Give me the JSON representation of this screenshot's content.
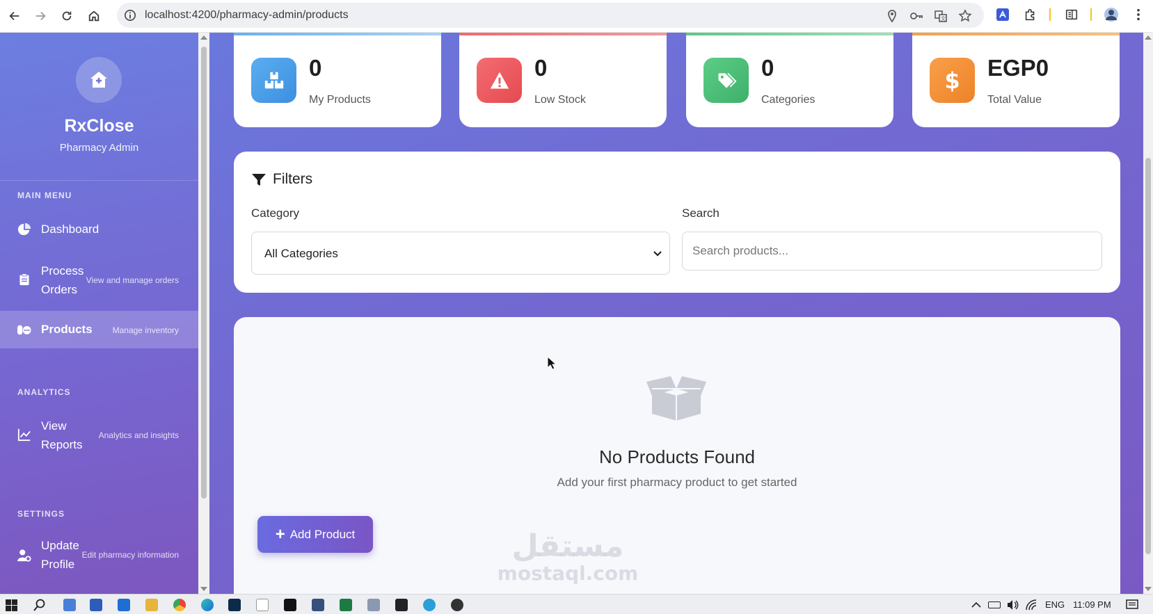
{
  "browser": {
    "url": "localhost:4200/pharmacy-admin/products"
  },
  "sidebar": {
    "brand_name": "RxClose",
    "brand_subtitle": "Pharmacy Admin",
    "sections": {
      "main": "MAIN MENU",
      "analytics": "ANALYTICS",
      "settings": "SETTINGS"
    },
    "items": [
      {
        "title": "Dashboard",
        "desc": "",
        "icon": "pie-chart-icon",
        "active": false
      },
      {
        "title": "Process\nOrders",
        "desc": "View and manage orders",
        "icon": "clipboard-icon",
        "active": false
      },
      {
        "title": "Products",
        "desc": "Manage inventory",
        "icon": "pills-icon",
        "active": true
      },
      {
        "title": "View\nReports",
        "desc": "Analytics and insights",
        "icon": "line-chart-icon",
        "active": false
      },
      {
        "title": "Update\nProfile",
        "desc": "Edit pharmacy information",
        "icon": "user-cog-icon",
        "active": false
      }
    ]
  },
  "stats": [
    {
      "value": "0",
      "label": "My Products",
      "color": "#4a9fe8",
      "icon": "boxes-icon"
    },
    {
      "value": "0",
      "label": "Low Stock",
      "color": "#ec5a5f",
      "icon": "warning-icon"
    },
    {
      "value": "0",
      "label": "Categories",
      "color": "#4fc27a",
      "icon": "tags-icon"
    },
    {
      "value": "EGP0",
      "label": "Total Value",
      "color": "#f4933a",
      "icon": "dollar-icon"
    }
  ],
  "filters": {
    "title": "Filters",
    "category_label": "Category",
    "category_value": "All Categories",
    "search_label": "Search",
    "search_placeholder": "Search products..."
  },
  "empty_state": {
    "title": "No Products Found",
    "subtitle": "Add your first pharmacy product to get started",
    "add_button": "Add Product"
  },
  "watermark": {
    "arabic": "مستقل",
    "latin": "mostaql.com"
  },
  "taskbar": {
    "language": "ENG",
    "time": "11:09 PM"
  },
  "colors": {
    "accent": "#6f6fd8",
    "sidebar_top": "#6c7ee0",
    "sidebar_bottom": "#7d57bf"
  }
}
